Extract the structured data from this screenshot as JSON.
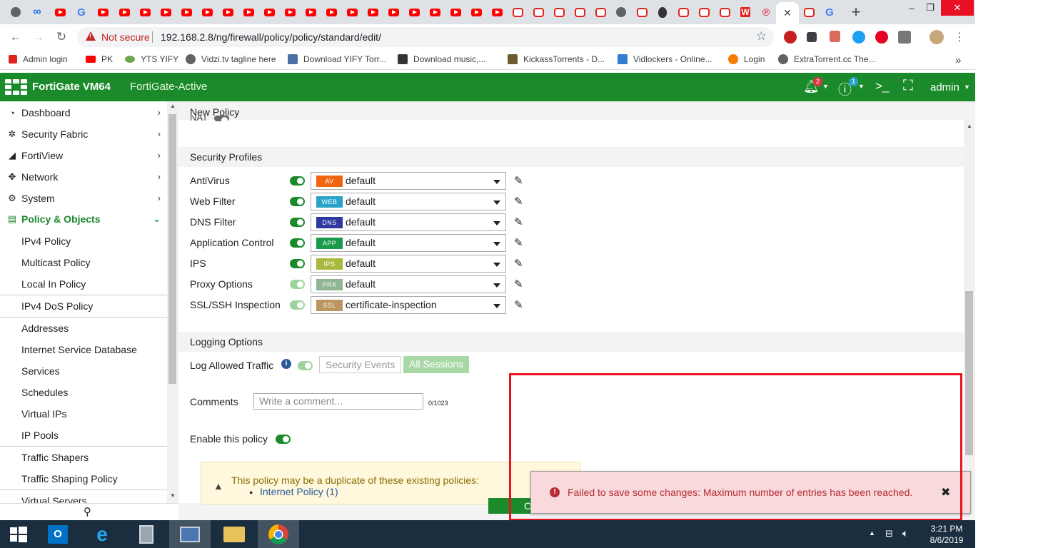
{
  "browser": {
    "url_security": "Not secure",
    "url": "192.168.2.8/ng/firewall/policy/policy/standard/edit/",
    "bookmarks": [
      "Admin login",
      "PK",
      "YTS YIFY",
      "Vidzi.tv tagline here",
      "Download YIFY Torr...",
      "Download music,...",
      "KickassTorrents - D...",
      "Vidlockers - Online...",
      "Login",
      "ExtraTorrent.cc The..."
    ],
    "bookmarks_overflow": "»",
    "window_controls": {
      "minimize": "–",
      "restore": "❐",
      "close": "✕"
    },
    "new_tab": "+",
    "tab_close": "✕"
  },
  "header": {
    "product": "FortiGate VM64",
    "hostname": "FortiGate-Active",
    "notification_count": "2",
    "help_count": "1",
    "cli_symbol": ">_",
    "user": "admin",
    "accent_color": "#1a8a2a"
  },
  "sidebar": {
    "top_items": [
      "Dashboard",
      "Security Fabric",
      "FortiView",
      "Network",
      "System"
    ],
    "group": "Policy & Objects",
    "selected": "IPv4 Policy",
    "sub_items": [
      "Multicast Policy",
      "Local In Policy",
      "IPv4 DoS Policy",
      "Addresses",
      "Internet Service Database",
      "Services",
      "Schedules",
      "Virtual IPs",
      "IP Pools",
      "Traffic Shapers",
      "Traffic Shaping Policy",
      "Virtual Servers"
    ]
  },
  "main": {
    "title": "New Policy",
    "nat_label": "NAT",
    "security_profiles_header": "Security Profiles",
    "profiles": [
      {
        "label": "AntiVirus",
        "tag": "AV",
        "value": "default",
        "tag_color": "#f0650f",
        "enabled": true
      },
      {
        "label": "Web Filter",
        "tag": "WEB",
        "value": "default",
        "tag_color": "#2aa3c9",
        "enabled": true
      },
      {
        "label": "DNS Filter",
        "tag": "DNS",
        "value": "default",
        "tag_color": "#2e3a9e",
        "enabled": true
      },
      {
        "label": "Application Control",
        "tag": "APP",
        "value": "default",
        "tag_color": "#1a9a4a",
        "enabled": true
      },
      {
        "label": "IPS",
        "tag": "IPS",
        "value": "default",
        "tag_color": "#a9b83e",
        "enabled": true
      },
      {
        "label": "Proxy Options",
        "tag": "PRX",
        "value": "default",
        "tag_color": "#8fb593",
        "enabled": false
      },
      {
        "label": "SSL/SSH Inspection",
        "tag": "SSL",
        "value": "certificate-inspection",
        "tag_color": "#b99660",
        "enabled": false
      }
    ],
    "logging_header": "Logging Options",
    "log_allowed_label": "Log Allowed Traffic",
    "log_options": [
      "Security Events",
      "All Sessions"
    ],
    "comments_label": "Comments",
    "comments_placeholder": "Write a comment...",
    "comments_counter": "0/1023",
    "enable_label": "Enable this policy",
    "duplicate_warning": "This policy may be a duplicate of these existing policies:",
    "duplicate_link": "Internet Policy (1)",
    "ok_button": "OK"
  },
  "toast": {
    "message": "Failed to save some changes: Maximum number of entries has been reached."
  },
  "taskbar": {
    "time": "3:21 PM",
    "date": "8/6/2019"
  }
}
